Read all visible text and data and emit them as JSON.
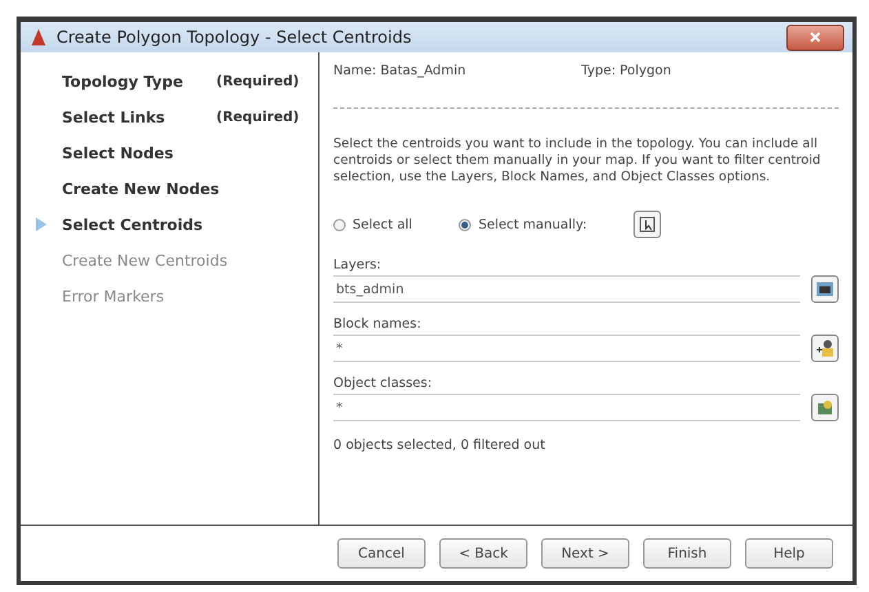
{
  "window": {
    "title": "Create Polygon Topology - Select Centroids"
  },
  "steps": [
    {
      "label": "Topology Type",
      "note": "(Required)",
      "selected": false,
      "disabled": false
    },
    {
      "label": "Select Links",
      "note": "(Required)",
      "selected": false,
      "disabled": false
    },
    {
      "label": "Select Nodes",
      "selected": false,
      "disabled": false
    },
    {
      "label": "Create New Nodes",
      "selected": false,
      "disabled": false
    },
    {
      "label": "Select Centroids",
      "selected": true,
      "disabled": false
    },
    {
      "label": "Create New Centroids",
      "selected": false,
      "disabled": true
    },
    {
      "label": "Error Markers",
      "selected": false,
      "disabled": true
    }
  ],
  "info": {
    "name": "Name: Batas_Admin",
    "type": "Type: Polygon"
  },
  "description": "Select the centroids you want to include in the topology. You can include all centroids or select them manually in your map. If you want to filter centroid selection, use the Layers, Block Names, and Object Classes options.",
  "options": [
    {
      "label": "Select all",
      "selected": false
    },
    {
      "label": "Select manually:",
      "selected": true
    }
  ],
  "filters": [
    {
      "label": "Layers:",
      "value": "bts_admin"
    },
    {
      "label": "Block names:",
      "value": "*"
    },
    {
      "label": "Object classes:",
      "value": "*"
    }
  ],
  "status": "0 objects selected, 0 filtered out",
  "buttons": [
    "Cancel",
    "< Back",
    "Next >",
    "Finish",
    "Help"
  ]
}
